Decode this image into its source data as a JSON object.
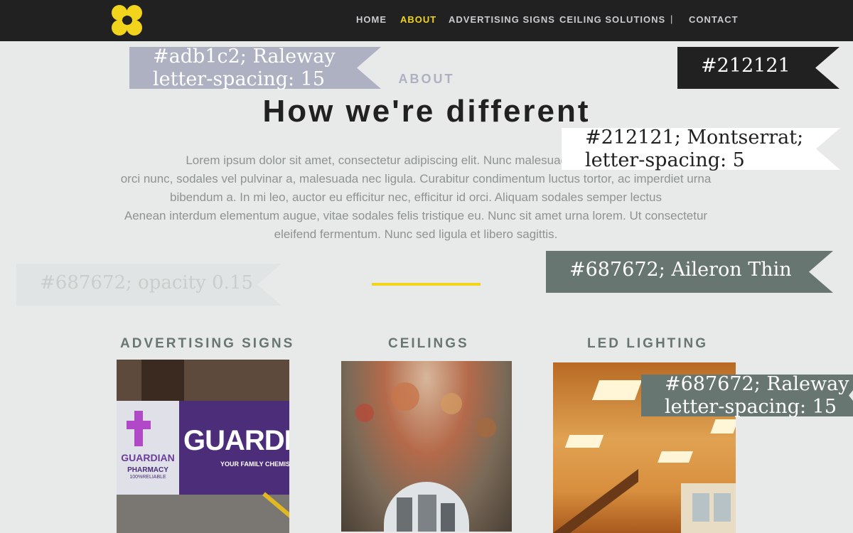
{
  "nav": {
    "items": [
      "HOME",
      "ABOUT",
      "ADVERTISING SIGNS",
      "CEILING SOLUTIONS",
      "CONTACT"
    ],
    "separator": "|"
  },
  "about": {
    "eyebrow": "ABOUT",
    "title": "How we're different",
    "lead": [
      "Lorem ipsum dolor sit amet, consectetur adipiscing elit. Nunc malesuada pellentesque",
      "orci nunc, sodales vel pulvinar a, malesuada nec ligula. Curabitur condimentum luctus tortor, ac imperdiet urna",
      "bibendum a. In mi leo, auctor eu efficitur nec, efficitur id orci. Aliquam sodales semper lectus",
      "Aenean interdum elementum augue, vitae sodales felis tristique eu. Nunc sit amet urna lorem. Ut consectetur",
      "eleifend fermentum. Nunc sed ligula et libero sagittis."
    ]
  },
  "services": [
    {
      "title": "ADVERTISING SIGNS"
    },
    {
      "title": "CEILINGS"
    },
    {
      "title": "LED LIGHTING"
    }
  ],
  "sign_image": {
    "brand": "GUARDIAN",
    "tagline": "YOUR FAMILY CHEMIST",
    "small_brand": "GUARDIAN",
    "small_sub": "PHARMACY",
    "small_sub2": "100%RELIABLE"
  },
  "annotations": {
    "a1": [
      "#adb1c2; Raleway",
      "letter-spacing: 15"
    ],
    "a2": [
      "#212121"
    ],
    "a3": [
      "#212121; Montserrat;",
      "letter-spacing: 5"
    ],
    "a4": [
      "#687672; opacity 0.15"
    ],
    "a5": [
      "#687672; Aileron Thin"
    ],
    "a6": [
      "#687672; Raleway",
      "letter-spacing: 15"
    ]
  },
  "colors": {
    "nav_bg": "#212121",
    "accent": "#f2d41c",
    "muted": "#adb1c2",
    "body_text": "#687672",
    "page_bg": "#e8e9e9"
  }
}
